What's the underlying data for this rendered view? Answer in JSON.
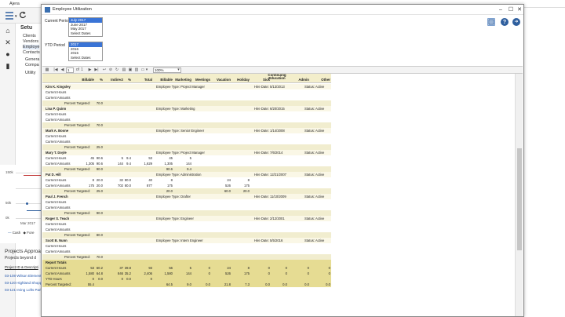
{
  "app": {
    "title": "Ajera",
    "menu": {
      "heading": "Setu",
      "items": [
        "Clients",
        "Vendors",
        "Employe",
        "Contacts",
        "Genera",
        "Compa",
        "Utility"
      ]
    },
    "chart": {
      "ticks": [
        "150k",
        "50k",
        "0k"
      ],
      "xlabel": "Mar 2017",
      "legend": [
        "Cash",
        "Fore"
      ]
    },
    "projects": {
      "title": "Projects Approa",
      "subtitle": "Projects beyond d",
      "header": "Project ID & Descripti",
      "links": [
        "03-108 Wilson Elementar",
        "03-120 Highland Shoppin",
        "03-121 Irving Lofts Parkin"
      ]
    }
  },
  "window": {
    "title": "Employee Utilization",
    "current_period_label": "Current Period",
    "current_period_options": [
      "July 2017",
      "June 2017",
      "May 2017",
      "Select Dates"
    ],
    "ytd_period_label": "YTD Period",
    "ytd_period_options": [
      "2017",
      "2016",
      "2015",
      "Select Dates"
    ],
    "toolbar": {
      "page": "1",
      "of_label": "of",
      "page_count": "1",
      "zoom": "100%"
    }
  },
  "report": {
    "columns": [
      "Billable",
      "%",
      "Indirect",
      "%",
      "Total",
      "Billable",
      "Marketing",
      "Meetings",
      "Vacation",
      "Holiday",
      "Sick",
      "Continuing Education",
      "Admin",
      "Other"
    ],
    "row_labels": {
      "hours": "Current Hours",
      "amounts": "Current Amounts",
      "ytd": "YTD Hours",
      "pct": "Percent Targeted:"
    },
    "employees": [
      {
        "name": "Kim K. Kingsley",
        "type": "Employee Type: Project Manager",
        "hire": "Hire Date: 5/13/2013",
        "status": "Status: Active",
        "pct": "70.0",
        "hours": [],
        "amounts": [],
        "ytd": []
      },
      {
        "name": "Lisa P. Quinn",
        "type": "Employee Type: Marketing",
        "hire": "Hire Date: 6/20/2015",
        "status": "Status: Active",
        "pct": "70.0",
        "hours": [],
        "amounts": [],
        "ytd": []
      },
      {
        "name": "Mark A. Boone",
        "type": "Employee Type: Senior Engineer",
        "hire": "Hire Date: 1/14/2008",
        "status": "Status: Active",
        "pct": "25.0",
        "hours": [],
        "amounts": [],
        "ytd": []
      },
      {
        "name": "Mary T. Doyle",
        "type": "Employee Type: Project Manager",
        "hire": "Hire Date: 7/6/2014",
        "status": "Status: Active",
        "pct": "90.0",
        "hours": [
          "45",
          "90.6",
          "5",
          "9.4",
          "53",
          "45",
          "5",
          "",
          "",
          "",
          "",
          "",
          "",
          ""
        ],
        "amounts": [
          "1,305",
          "90.6",
          "144",
          "9.4",
          "1,629",
          "1,305",
          "144",
          "",
          "",
          "",
          "",
          "",
          "",
          ""
        ],
        "ytd": [
          "",
          "",
          "",
          "",
          "",
          "90.6",
          "9.4",
          "",
          "",
          "",
          "",
          "",
          "",
          ""
        ]
      },
      {
        "name": "Pat D. Hill",
        "type": "Employee Type: Administration",
        "hire": "Hire Date: 12/21/2007",
        "status": "Status: Active",
        "pct": "25.0",
        "hours": [
          "8",
          "20.0",
          "32",
          "80.0",
          "40",
          "8",
          "",
          "",
          "24",
          "8",
          "",
          "",
          "",
          ""
        ],
        "amounts": [
          "175",
          "20.0",
          "702",
          "80.0",
          "877",
          "175",
          "",
          "",
          "526",
          "175",
          "",
          "",
          "",
          ""
        ],
        "ytd": [
          "",
          "",
          "",
          "",
          "",
          "20.0",
          "",
          "",
          "60.0",
          "20.0",
          "",
          "",
          "",
          ""
        ]
      },
      {
        "name": "Paul J. French",
        "type": "Employee Type: Drafter",
        "hire": "Hire Date: 11/10/2009",
        "status": "Status: Active",
        "pct": "90.0",
        "hours": [],
        "amounts": [],
        "ytd": []
      },
      {
        "name": "Roger S. Teach",
        "type": "Employee Type: Engineer",
        "hire": "Hire Date: 2/12/2001",
        "status": "Status: Active",
        "pct": "80.0",
        "hours": [],
        "amounts": [],
        "ytd": []
      },
      {
        "name": "Scott B. Nunn",
        "type": "Employee Type: Intern Engineer",
        "hire": "Hire Date: 5/5/2016",
        "status": "Status: Active",
        "pct": "70.0",
        "hours": [],
        "amounts": [],
        "ytd": []
      }
    ],
    "totals": {
      "label": "Report Totals",
      "hours": [
        "53",
        "60.2",
        "37",
        "39.8",
        "93",
        "56",
        "5",
        "0",
        "24",
        "8",
        "0",
        "0",
        "0",
        "0"
      ],
      "amounts": [
        "1,580",
        "64.8",
        "846",
        "35.2",
        "2,406",
        "1,580",
        "144",
        "0",
        "526",
        "175",
        "0",
        "0",
        "0",
        "0"
      ],
      "ytd": [
        "0",
        "0.0",
        "0",
        "0.0",
        "0",
        "",
        "",
        "",
        "",
        "",
        "",
        "",
        "",
        ""
      ],
      "pct": [
        "55.4",
        "",
        "",
        "",
        "",
        "64.5",
        "9.0",
        "0.0",
        "21.8",
        "7.3",
        "0.0",
        "0.0",
        "0.0",
        "0.0"
      ]
    }
  }
}
